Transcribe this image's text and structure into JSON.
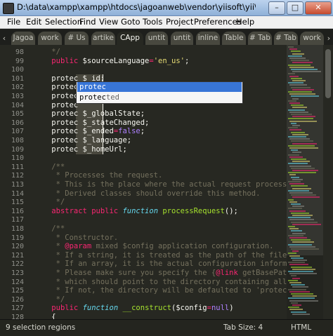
{
  "window": {
    "title": "D:\\data\\xampp\\xampp\\htdocs\\jagoanweb\\vendor\\yiisoft\\yii\\framework\\base\\CAppli...",
    "minimize_label": "–",
    "maximize_label": "□",
    "close_label": "✕"
  },
  "menu": [
    "File",
    "Edit",
    "Selection",
    "Find",
    "View",
    "Goto",
    "Tools",
    "Project",
    "Preferences",
    "Help"
  ],
  "tabs": {
    "left_arrow": "‹",
    "right_arrow": "›",
    "items": [
      "Jagoa",
      "work",
      "# Us",
      "artike",
      "CApp",
      "untit",
      "untit",
      "inline",
      "Table",
      "# Tab",
      "# Tab",
      "work"
    ],
    "active_index": 4
  },
  "editor": {
    "line_numbers": [
      "98",
      "99",
      "100",
      "101",
      "102",
      "103",
      "104",
      "105",
      "106",
      "107",
      "108",
      "109",
      "110",
      "111",
      "112",
      "113",
      "114",
      "115",
      "116",
      "117",
      "118",
      "119",
      "120",
      "121",
      "122",
      "123",
      "124",
      "125",
      "126",
      "127",
      "128",
      "129"
    ],
    "lines": [
      [
        {
          "t": "    */",
          "c": "cmt"
        }
      ],
      [
        {
          "t": "    ",
          "c": "var"
        },
        {
          "t": "public",
          "c": "kw"
        },
        {
          "t": " $sourceLanguage",
          "c": "var"
        },
        {
          "t": "=",
          "c": "kw"
        },
        {
          "t": "'en_us'",
          "c": "str"
        },
        {
          "t": ";",
          "c": "var"
        }
      ],
      [],
      [
        {
          "t": "    ",
          "c": "var"
        },
        {
          "t": "protec",
          "c": "var"
        },
        {
          "t": " $_id;",
          "c": "var"
        }
      ],
      [
        {
          "t": "    ",
          "c": "var"
        },
        {
          "t": "protec",
          "c": "var"
        }
      ],
      [
        {
          "t": "    ",
          "c": "var"
        },
        {
          "t": "protec",
          "c": "var"
        }
      ],
      [
        {
          "t": "    ",
          "c": "var"
        },
        {
          "t": "protec",
          "c": "var"
        }
      ],
      [
        {
          "t": "    ",
          "c": "var"
        },
        {
          "t": "protec",
          "c": "var"
        },
        {
          "t": " $_globalState;",
          "c": "var"
        }
      ],
      [
        {
          "t": "    ",
          "c": "var"
        },
        {
          "t": "protec",
          "c": "var"
        },
        {
          "t": " $_stateChanged;",
          "c": "var"
        }
      ],
      [
        {
          "t": "    ",
          "c": "var"
        },
        {
          "t": "protec",
          "c": "var"
        },
        {
          "t": " $_ended",
          "c": "var"
        },
        {
          "t": "=",
          "c": "kw"
        },
        {
          "t": "false",
          "c": "num"
        },
        {
          "t": ";",
          "c": "var"
        }
      ],
      [
        {
          "t": "    ",
          "c": "var"
        },
        {
          "t": "protec",
          "c": "var"
        },
        {
          "t": " $_language;",
          "c": "var"
        }
      ],
      [
        {
          "t": "    ",
          "c": "var"
        },
        {
          "t": "protec",
          "c": "var"
        },
        {
          "t": " $_homeUrl;",
          "c": "var"
        }
      ],
      [],
      [
        {
          "t": "    /**",
          "c": "cmt"
        }
      ],
      [
        {
          "t": "     * Processes the request.",
          "c": "cmt"
        }
      ],
      [
        {
          "t": "     * This is the place where the actual request processing work",
          "c": "cmt"
        }
      ],
      [
        {
          "t": "     * Derived classes should override this method.",
          "c": "cmt"
        }
      ],
      [
        {
          "t": "     */",
          "c": "cmt"
        }
      ],
      [
        {
          "t": "    ",
          "c": "var"
        },
        {
          "t": "abstract public ",
          "c": "kw"
        },
        {
          "t": "function",
          "c": "stor"
        },
        {
          "t": " ",
          "c": "var"
        },
        {
          "t": "processRequest",
          "c": "fn"
        },
        {
          "t": "();",
          "c": "var"
        }
      ],
      [],
      [
        {
          "t": "    /**",
          "c": "cmt"
        }
      ],
      [
        {
          "t": "     * Constructor.",
          "c": "cmt"
        }
      ],
      [
        {
          "t": "     * ",
          "c": "cmt"
        },
        {
          "t": "@param",
          "c": "doc"
        },
        {
          "t": " mixed $config application configuration.",
          "c": "cmt"
        }
      ],
      [
        {
          "t": "     * If a string, it is treated as the path of the file that co",
          "c": "cmt"
        }
      ],
      [
        {
          "t": "     * If an array, it is the actual configuration information.",
          "c": "cmt"
        }
      ],
      [
        {
          "t": "     * Please make sure you specify the {",
          "c": "cmt"
        },
        {
          "t": "@link",
          "c": "doc"
        },
        {
          "t": " getBasePath basePa",
          "c": "cmt"
        }
      ],
      [
        {
          "t": "     * which should point to the directory containing all applica",
          "c": "cmt"
        }
      ],
      [
        {
          "t": "     * If not, the directory will be defaulted to 'protected'.",
          "c": "cmt"
        }
      ],
      [
        {
          "t": "     */",
          "c": "cmt"
        }
      ],
      [
        {
          "t": "    ",
          "c": "var"
        },
        {
          "t": "public",
          "c": "kw"
        },
        {
          "t": " ",
          "c": "var"
        },
        {
          "t": "function",
          "c": "stor"
        },
        {
          "t": " ",
          "c": "var"
        },
        {
          "t": "__construct",
          "c": "fn"
        },
        {
          "t": "(",
          "c": "var"
        },
        {
          "t": "$config",
          "c": "var"
        },
        {
          "t": "=",
          "c": "kw"
        },
        {
          "t": "null",
          "c": "num"
        },
        {
          "t": ")",
          "c": "var"
        }
      ],
      [
        {
          "t": "    {",
          "c": "var"
        }
      ],
      [
        {
          "t": "        ",
          "c": "var"
        },
        {
          "t": "Yii",
          "c": "stor"
        },
        {
          "t": "::",
          "c": "kw"
        },
        {
          "t": "setApplication",
          "c": "fn"
        },
        {
          "t": "($this);",
          "c": "var"
        }
      ]
    ]
  },
  "autocomplete": {
    "selected": "protec",
    "option_prefix": "protec",
    "option_rest": "ted"
  },
  "status": {
    "selection": "9 selection regions",
    "tab_size": "Tab Size: 4",
    "syntax": "HTML"
  },
  "colors": {
    "background": "#272822",
    "comment": "#75715e",
    "keyword": "#f92672",
    "string": "#e6db74",
    "function": "#a6e22e",
    "storage": "#66d9ef",
    "number": "#ae81ff"
  }
}
